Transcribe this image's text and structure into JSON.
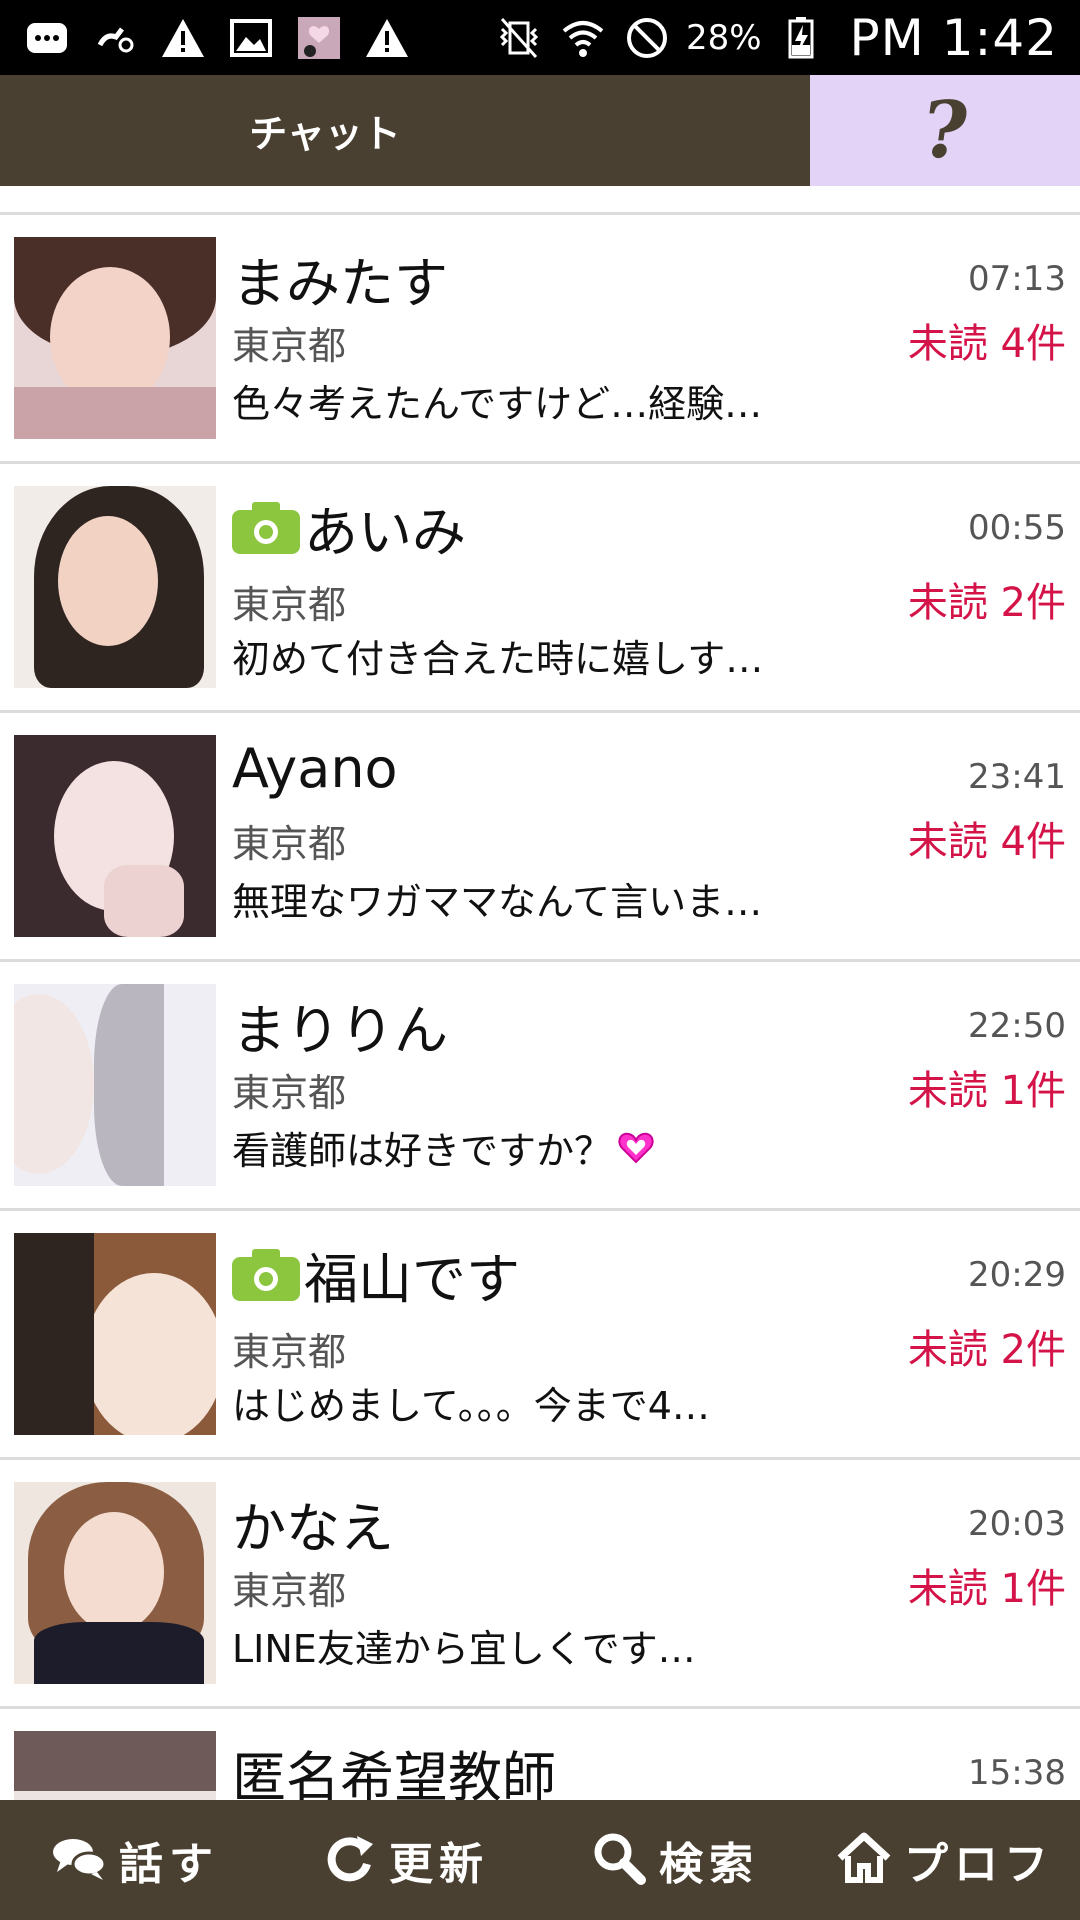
{
  "status_bar": {
    "icons": [
      "chat-bubble-icon",
      "missed-call-icon",
      "warning-icon",
      "gallery-icon",
      "app-notification-icon",
      "warning-icon",
      "vibrate-icon",
      "wifi-icon",
      "do-not-disturb-icon",
      "battery-charging-icon"
    ],
    "battery_percent": "28%",
    "time": "PM 1:42"
  },
  "header": {
    "title": "チャット",
    "help_icon": "question-mark-icon",
    "colors": {
      "bar": "#4a4032",
      "help_bg": "#e3d4f7"
    }
  },
  "chats": [
    {
      "name": "まみたす",
      "has_photo_badge": false,
      "time": "07:13",
      "location": "東京都",
      "unread": "未読 4件",
      "preview": "色々考えたんですけど…経験…",
      "preview_icon": ""
    },
    {
      "name": "あいみ",
      "has_photo_badge": true,
      "time": "00:55",
      "location": "東京都",
      "unread": "未読 2件",
      "preview": "初めて付き合えた時に嬉しす…",
      "preview_icon": ""
    },
    {
      "name": "Ayano",
      "has_photo_badge": false,
      "time": "23:41",
      "location": "東京都",
      "unread": "未読 4件",
      "preview": "無理なワガママなんて言いま…",
      "preview_icon": ""
    },
    {
      "name": "まりりん",
      "has_photo_badge": false,
      "time": "22:50",
      "location": "東京都",
      "unread": "未読 1件",
      "preview": "看護師は好きですか？",
      "preview_icon": "heart-icon"
    },
    {
      "name": "福山です",
      "has_photo_badge": true,
      "time": "20:29",
      "location": "東京都",
      "unread": "未読 2件",
      "preview": "はじめまして。。。今まで4…",
      "preview_icon": ""
    },
    {
      "name": "かなえ",
      "has_photo_badge": false,
      "time": "20:03",
      "location": "東京都",
      "unread": "未読 1件",
      "preview": "LINE友達から宜しくです…",
      "preview_icon": ""
    },
    {
      "name": "匿名希望教師",
      "has_photo_badge": false,
      "time": "15:38",
      "location": "",
      "unread": "",
      "preview": "",
      "preview_icon": ""
    }
  ],
  "bottom_nav": [
    {
      "label": "話す",
      "icon": "chat-bubbles-icon"
    },
    {
      "label": "更新",
      "icon": "refresh-icon"
    },
    {
      "label": "検索",
      "icon": "search-icon"
    },
    {
      "label": "プロフ",
      "icon": "home-icon"
    }
  ],
  "colors": {
    "unread": "#d41449",
    "camera_badge": "#8cc63f",
    "heart": "#ff33cc"
  }
}
